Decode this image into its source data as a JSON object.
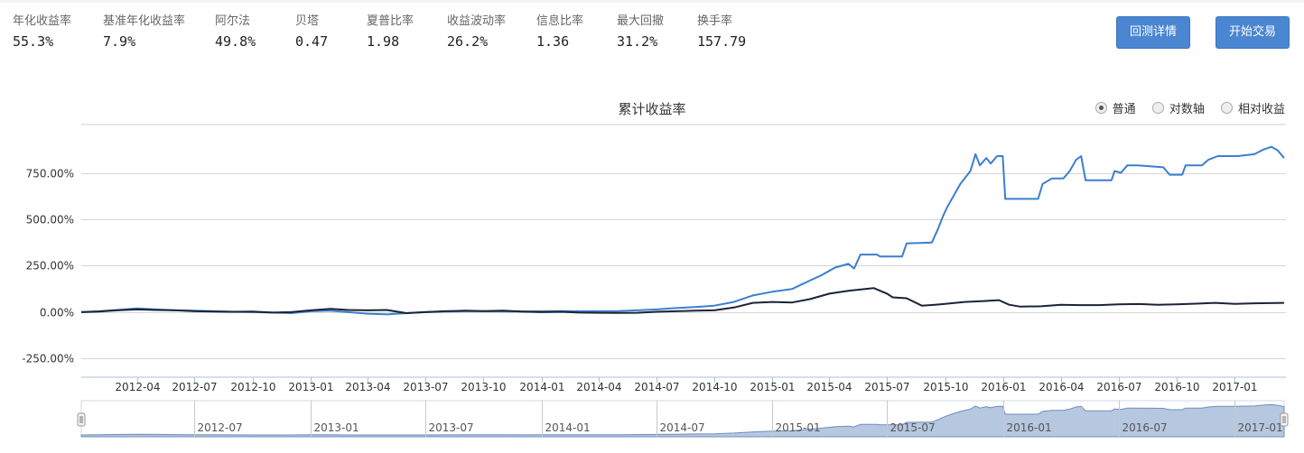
{
  "metrics": [
    {
      "label": "年化收益率",
      "value": "55.3%"
    },
    {
      "label": "基准年化收益率",
      "value": "7.9%"
    },
    {
      "label": "阿尔法",
      "value": "49.8%"
    },
    {
      "label": "贝塔",
      "value": "0.47"
    },
    {
      "label": "夏普比率",
      "value": "1.98"
    },
    {
      "label": "收益波动率",
      "value": "26.2%"
    },
    {
      "label": "信息比率",
      "value": "1.36"
    },
    {
      "label": "最大回撤",
      "value": "31.2%"
    },
    {
      "label": "换手率",
      "value": "157.79"
    }
  ],
  "buttons": {
    "detail": "回测详情",
    "trade": "开始交易"
  },
  "scale_modes": {
    "normal": "普通",
    "log": "对数轴",
    "relative": "相对收益",
    "selected": "normal"
  },
  "colors": {
    "strategy": "#3b7fcf",
    "benchmark": "#1b2436",
    "button": "#4a86d1",
    "navigator_fill": "#b6c7e0"
  },
  "chart_data": {
    "type": "line",
    "title": "累计收益率",
    "y_tick_labels": [
      "-250.00%",
      "0.00%",
      "250.00%",
      "500.00%",
      "750.00%"
    ],
    "y_ticks": [
      -250,
      0,
      250,
      500,
      750
    ],
    "ylim": [
      -350,
      1010
    ],
    "xlim": [
      "2012-01-04",
      "2017-03-20"
    ],
    "x_tick_labels": [
      "2012-04",
      "2012-07",
      "2012-10",
      "2013-01",
      "2013-04",
      "2013-07",
      "2013-10",
      "2014-01",
      "2014-04",
      "2014-07",
      "2014-10",
      "2015-01",
      "2015-04",
      "2015-07",
      "2015-10",
      "2016-01",
      "2016-04",
      "2016-07",
      "2016-10",
      "2017-01"
    ],
    "x_ticks": [
      "2012-04-01",
      "2012-07-01",
      "2012-10-01",
      "2013-01-01",
      "2013-04-01",
      "2013-07-01",
      "2013-10-01",
      "2014-01-01",
      "2014-04-01",
      "2014-07-01",
      "2014-10-01",
      "2015-01-01",
      "2015-04-01",
      "2015-07-01",
      "2015-10-01",
      "2016-01-01",
      "2016-04-01",
      "2016-07-01",
      "2016-10-01",
      "2017-01-01"
    ],
    "grid": true,
    "series": [
      {
        "key": "strategy",
        "color": "#3b7fcf",
        "points": [
          [
            "2012-01-04",
            0
          ],
          [
            "2012-02-01",
            5
          ],
          [
            "2012-03-01",
            12
          ],
          [
            "2012-04-01",
            20
          ],
          [
            "2012-05-01",
            15
          ],
          [
            "2012-06-01",
            10
          ],
          [
            "2012-07-01",
            8
          ],
          [
            "2012-08-01",
            5
          ],
          [
            "2012-09-01",
            2
          ],
          [
            "2012-10-01",
            0
          ],
          [
            "2012-11-01",
            -2
          ],
          [
            "2012-12-01",
            -5
          ],
          [
            "2013-01-01",
            5
          ],
          [
            "2013-02-01",
            8
          ],
          [
            "2013-03-01",
            0
          ],
          [
            "2013-04-01",
            -8
          ],
          [
            "2013-05-01",
            -12
          ],
          [
            "2013-06-01",
            -5
          ],
          [
            "2013-07-01",
            0
          ],
          [
            "2013-08-01",
            3
          ],
          [
            "2013-09-01",
            5
          ],
          [
            "2013-10-01",
            5
          ],
          [
            "2013-11-01",
            4
          ],
          [
            "2013-12-01",
            3
          ],
          [
            "2014-01-01",
            5
          ],
          [
            "2014-02-01",
            6
          ],
          [
            "2014-03-01",
            5
          ],
          [
            "2014-04-01",
            5
          ],
          [
            "2014-05-01",
            6
          ],
          [
            "2014-06-01",
            10
          ],
          [
            "2014-07-01",
            15
          ],
          [
            "2014-08-01",
            22
          ],
          [
            "2014-09-01",
            28
          ],
          [
            "2014-10-01",
            35
          ],
          [
            "2014-11-01",
            55
          ],
          [
            "2014-12-01",
            90
          ],
          [
            "2015-01-01",
            110
          ],
          [
            "2015-02-01",
            125
          ],
          [
            "2015-03-01",
            170
          ],
          [
            "2015-03-20",
            200
          ],
          [
            "2015-04-10",
            240
          ],
          [
            "2015-05-01",
            260
          ],
          [
            "2015-05-10",
            235
          ],
          [
            "2015-05-20",
            310
          ],
          [
            "2015-06-15",
            310
          ],
          [
            "2015-06-20",
            300
          ],
          [
            "2015-07-25",
            300
          ],
          [
            "2015-08-01",
            370
          ],
          [
            "2015-09-10",
            375
          ],
          [
            "2015-09-20",
            450
          ],
          [
            "2015-09-28",
            520
          ],
          [
            "2015-10-05",
            570
          ],
          [
            "2015-10-25",
            690
          ],
          [
            "2015-11-10",
            760
          ],
          [
            "2015-11-18",
            850
          ],
          [
            "2015-11-25",
            790
          ],
          [
            "2015-12-05",
            830
          ],
          [
            "2015-12-12",
            800
          ],
          [
            "2015-12-22",
            840
          ],
          [
            "2015-12-31",
            840
          ],
          [
            "2016-01-04",
            610
          ],
          [
            "2016-02-25",
            610
          ],
          [
            "2016-03-03",
            690
          ],
          [
            "2016-03-18",
            720
          ],
          [
            "2016-04-05",
            720
          ],
          [
            "2016-04-15",
            760
          ],
          [
            "2016-04-25",
            820
          ],
          [
            "2016-05-03",
            840
          ],
          [
            "2016-05-10",
            710
          ],
          [
            "2016-06-20",
            710
          ],
          [
            "2016-06-25",
            760
          ],
          [
            "2016-07-05",
            750
          ],
          [
            "2016-07-15",
            790
          ],
          [
            "2016-08-01",
            790
          ],
          [
            "2016-09-10",
            780
          ],
          [
            "2016-09-20",
            740
          ],
          [
            "2016-10-10",
            740
          ],
          [
            "2016-10-15",
            790
          ],
          [
            "2016-11-10",
            790
          ],
          [
            "2016-11-20",
            820
          ],
          [
            "2016-12-05",
            840
          ],
          [
            "2017-01-05",
            840
          ],
          [
            "2017-02-01",
            850
          ],
          [
            "2017-02-15",
            875
          ],
          [
            "2017-02-28",
            890
          ],
          [
            "2017-03-10",
            870
          ],
          [
            "2017-03-20",
            830
          ]
        ]
      },
      {
        "key": "benchmark",
        "color": "#1b2436",
        "points": [
          [
            "2012-01-04",
            0
          ],
          [
            "2012-02-01",
            3
          ],
          [
            "2012-03-01",
            10
          ],
          [
            "2012-04-01",
            15
          ],
          [
            "2012-05-01",
            12
          ],
          [
            "2012-06-01",
            10
          ],
          [
            "2012-07-01",
            5
          ],
          [
            "2012-08-01",
            3
          ],
          [
            "2012-09-01",
            2
          ],
          [
            "2012-10-01",
            3
          ],
          [
            "2012-11-01",
            -2
          ],
          [
            "2012-12-01",
            0
          ],
          [
            "2013-01-01",
            10
          ],
          [
            "2013-02-01",
            18
          ],
          [
            "2013-03-01",
            12
          ],
          [
            "2013-04-01",
            10
          ],
          [
            "2013-05-01",
            12
          ],
          [
            "2013-06-01",
            -5
          ],
          [
            "2013-07-01",
            0
          ],
          [
            "2013-08-01",
            5
          ],
          [
            "2013-09-01",
            8
          ],
          [
            "2013-10-01",
            6
          ],
          [
            "2013-11-01",
            8
          ],
          [
            "2013-12-01",
            3
          ],
          [
            "2014-01-01",
            0
          ],
          [
            "2014-02-01",
            2
          ],
          [
            "2014-03-01",
            -2
          ],
          [
            "2014-04-01",
            -3
          ],
          [
            "2014-05-01",
            -4
          ],
          [
            "2014-06-01",
            -3
          ],
          [
            "2014-07-01",
            2
          ],
          [
            "2014-08-01",
            5
          ],
          [
            "2014-09-01",
            8
          ],
          [
            "2014-10-01",
            10
          ],
          [
            "2014-11-01",
            25
          ],
          [
            "2014-12-01",
            50
          ],
          [
            "2015-01-01",
            55
          ],
          [
            "2015-02-01",
            52
          ],
          [
            "2015-03-01",
            70
          ],
          [
            "2015-04-01",
            100
          ],
          [
            "2015-05-01",
            115
          ],
          [
            "2015-06-10",
            130
          ],
          [
            "2015-07-01",
            100
          ],
          [
            "2015-07-10",
            80
          ],
          [
            "2015-08-01",
            75
          ],
          [
            "2015-08-25",
            35
          ],
          [
            "2015-09-15",
            40
          ],
          [
            "2015-10-01",
            45
          ],
          [
            "2015-11-01",
            55
          ],
          [
            "2015-12-01",
            60
          ],
          [
            "2015-12-25",
            65
          ],
          [
            "2016-01-10",
            40
          ],
          [
            "2016-01-28",
            30
          ],
          [
            "2016-03-01",
            32
          ],
          [
            "2016-04-01",
            40
          ],
          [
            "2016-05-01",
            38
          ],
          [
            "2016-06-01",
            38
          ],
          [
            "2016-07-01",
            42
          ],
          [
            "2016-08-01",
            44
          ],
          [
            "2016-09-01",
            40
          ],
          [
            "2016-10-01",
            42
          ],
          [
            "2016-11-01",
            46
          ],
          [
            "2016-12-01",
            50
          ],
          [
            "2017-01-01",
            45
          ],
          [
            "2017-02-01",
            48
          ],
          [
            "2017-03-20",
            50
          ]
        ]
      }
    ]
  },
  "navigator": {
    "x_tick_labels": [
      "2012-07",
      "2013-01",
      "2013-07",
      "2014-01",
      "2014-07",
      "2015-01",
      "2015-07",
      "2016-01",
      "2016-07",
      "2017-01"
    ],
    "x_ticks": [
      "2012-07-01",
      "2013-01-01",
      "2013-07-01",
      "2014-01-01",
      "2014-07-01",
      "2015-01-01",
      "2015-07-01",
      "2016-01-01",
      "2016-07-01",
      "2017-01-01"
    ]
  }
}
